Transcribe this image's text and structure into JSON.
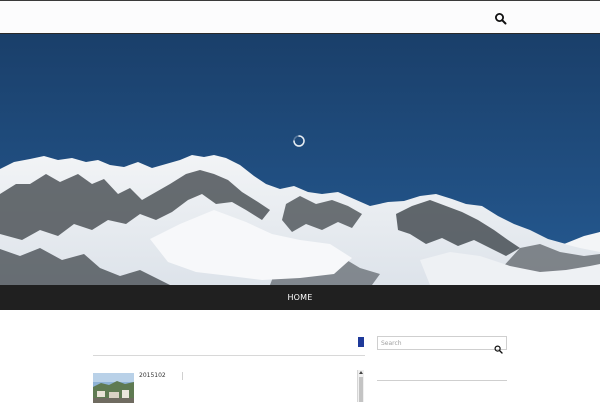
{
  "header": {
    "search_icon": "search-icon"
  },
  "hero": {
    "loading_icon": "loading-spinner-icon",
    "sky_color": "#1d4672"
  },
  "nav": {
    "items": [
      {
        "label": "HOME"
      }
    ],
    "background": "#202020"
  },
  "main": {
    "accent_color": "#1f3a9a",
    "posts": [
      {
        "title": "2015102"
      }
    ]
  },
  "sidebar": {
    "search": {
      "placeholder": "Search",
      "value": ""
    }
  }
}
